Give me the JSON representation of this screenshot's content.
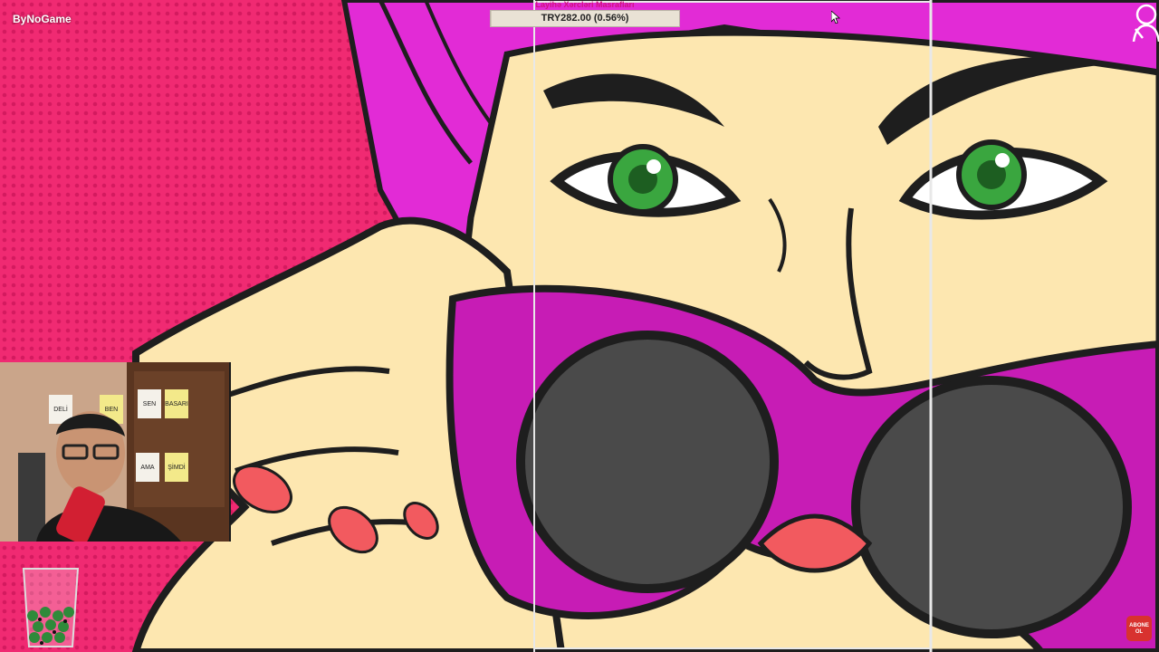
{
  "overlay": {
    "brand": "ByNoGame",
    "donation_goal": {
      "title": "Layihə Xərcləri Masrafları",
      "amount": "TRY282.00 (0.56%)",
      "progress_percent": 0.56
    },
    "subscribe_badge": "ABONE OL"
  },
  "webcam_posters": [
    "DELİ",
    "BEN",
    "SEN",
    "BASARI",
    "AMA",
    "ŞİMDİ"
  ],
  "puzzle": {
    "artwork": "pop-art woman lowering magenta sunglasses",
    "colors": {
      "background_pink": "#f02a72",
      "skin": "#fde7b0",
      "hair_magenta": "#e22bd6",
      "glasses_magenta": "#c71cb5",
      "eye_green": "#3aa63f",
      "lens_gray": "#4a4a4a",
      "outline": "#1e1e1e",
      "nails": "#f25a5f",
      "divider": "#e8e8e8"
    }
  },
  "icons": [
    "cursor-icon",
    "streamer-avatar-icon",
    "webcam-feed",
    "jellybean-cup-icon",
    "subscribe-icon"
  ]
}
